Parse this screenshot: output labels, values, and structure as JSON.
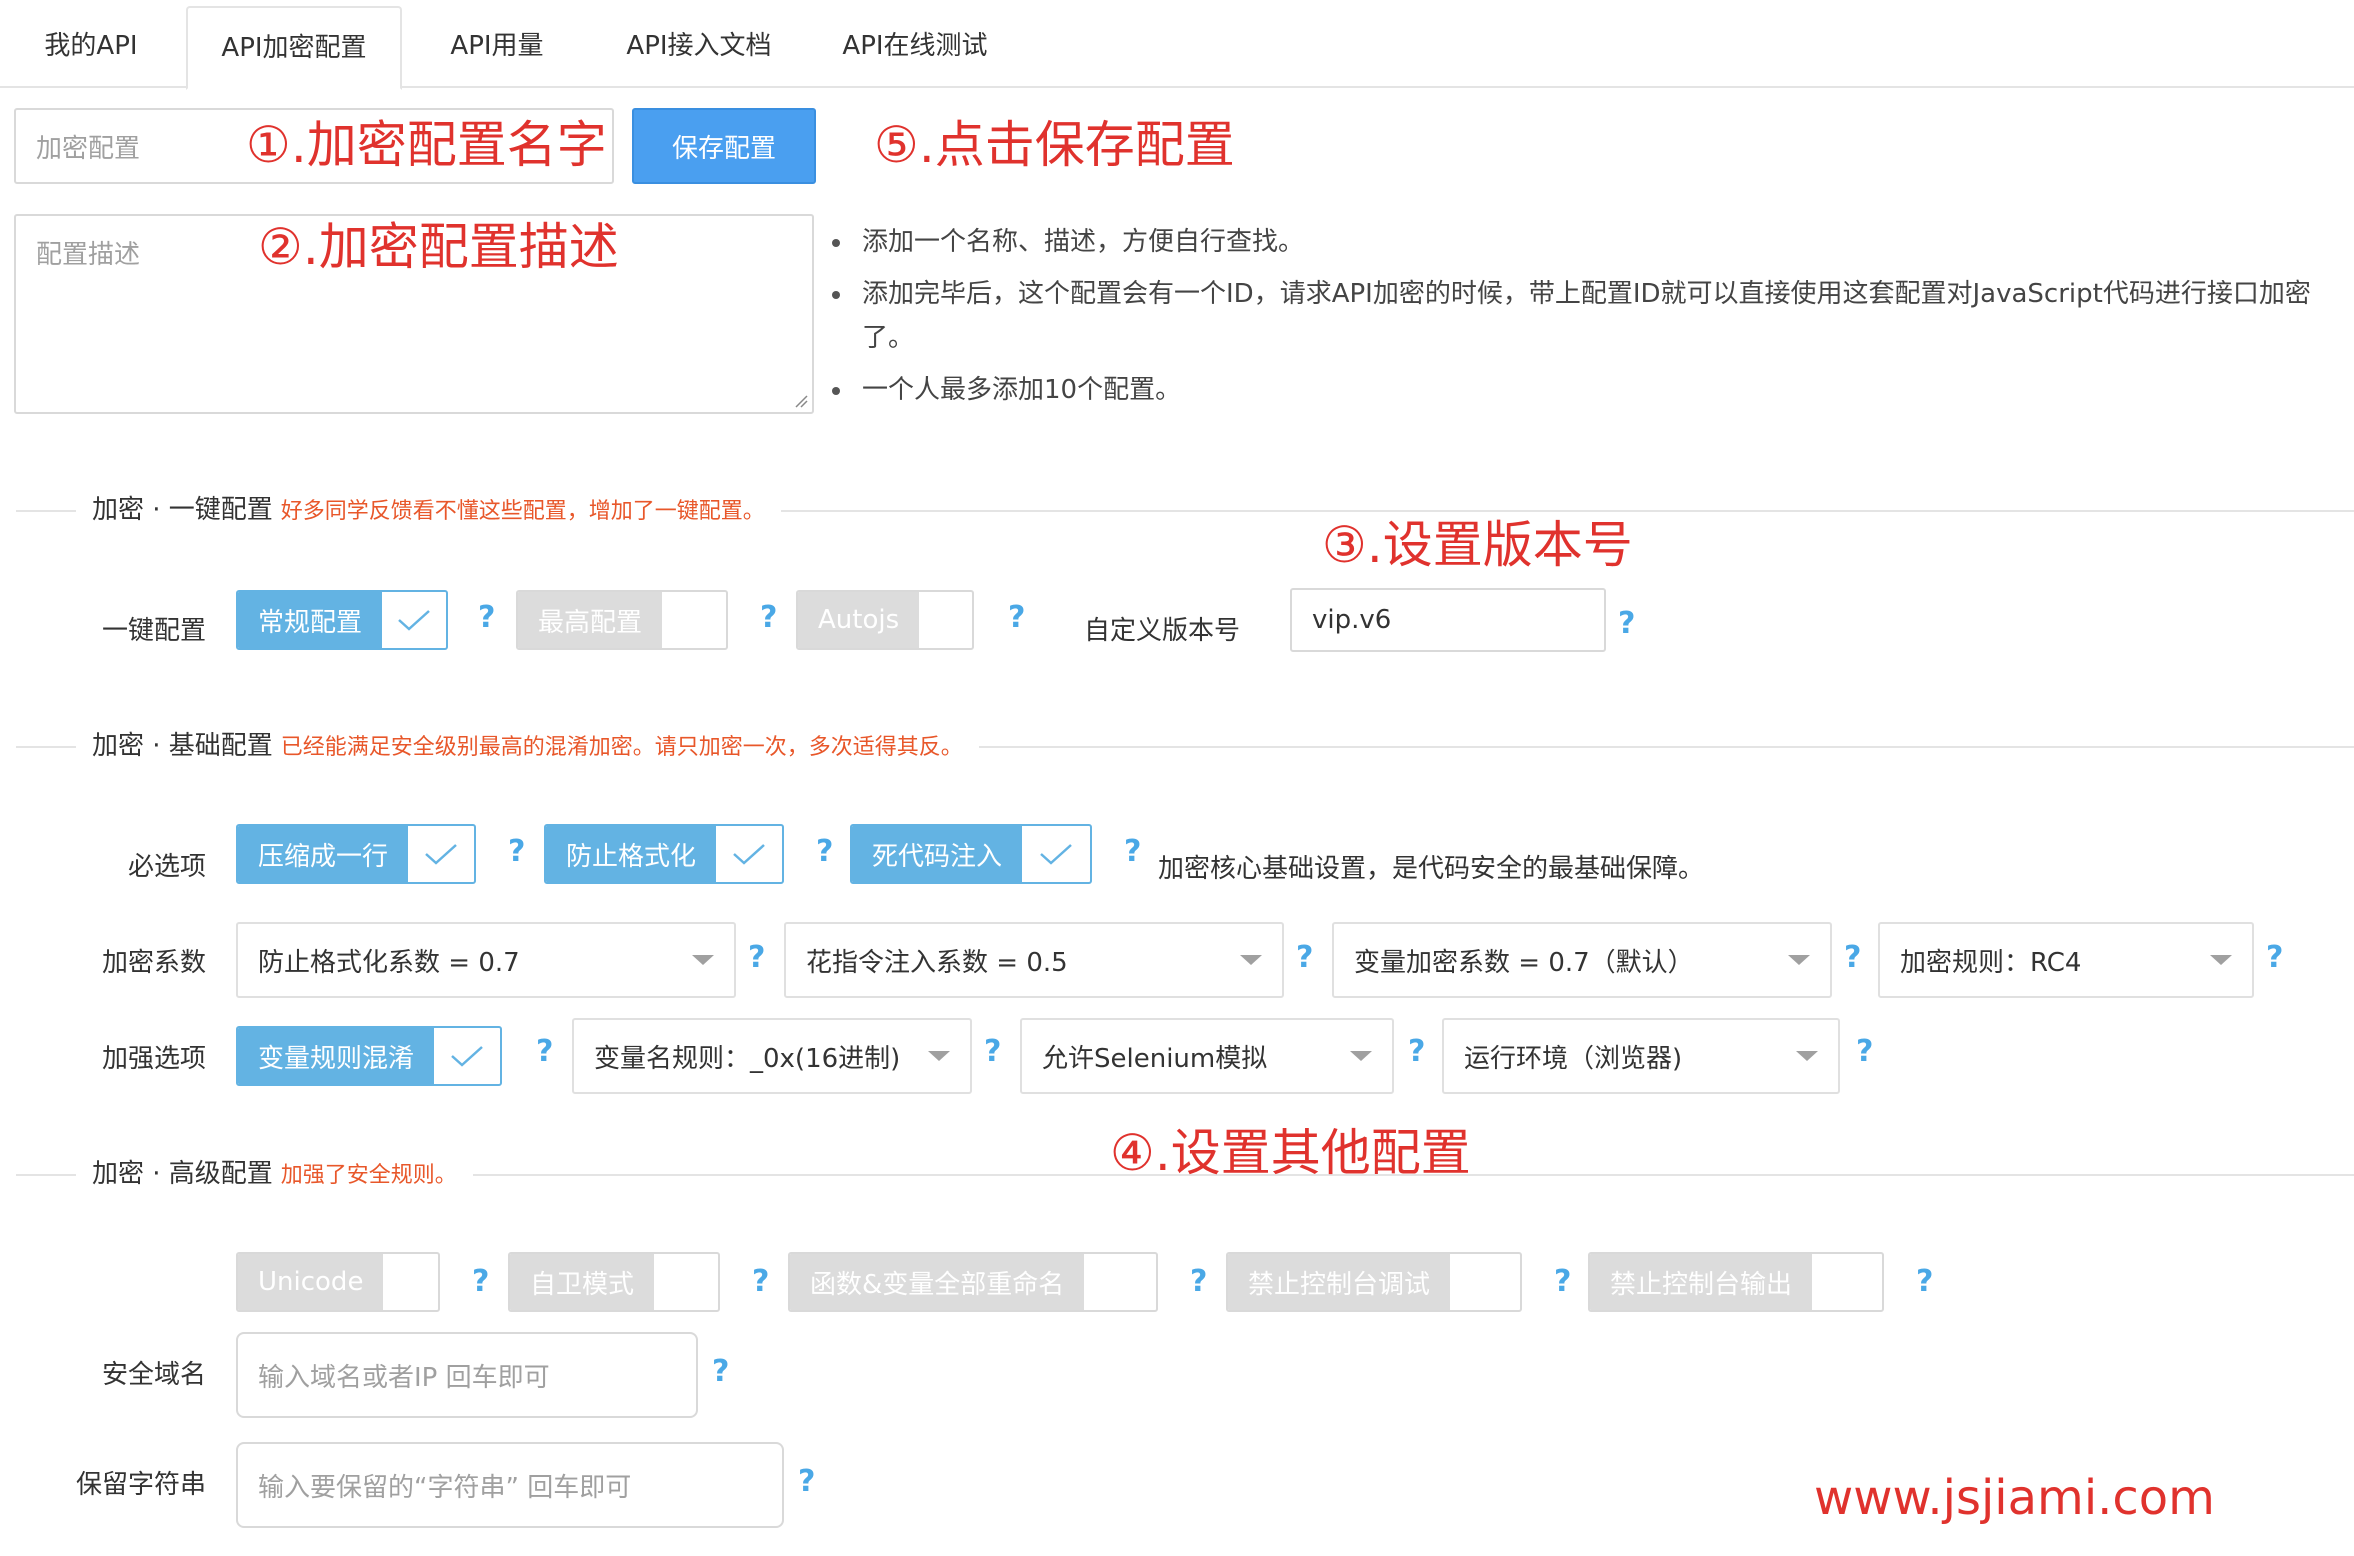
{
  "tabs": [
    "我的API",
    "API加密配置",
    "API用量",
    "API接入文档",
    "API在线测试"
  ],
  "config_name": {
    "placeholder": "加密配置",
    "save_label": "保存配置"
  },
  "config_desc": {
    "placeholder": "配置描述"
  },
  "annotations": {
    "a1": "①.加密配置名字",
    "a2": "②.加密配置描述",
    "a3": "③.设置版本号",
    "a4": "④.设置其他配置",
    "a5": "⑤.点击保存配置"
  },
  "tips": [
    "添加一个名称、描述，方便自行查找。",
    "添加完毕后，这个配置会有一个ID，请求API加密的时候，带上配置ID就可以直接使用这套配置对JavaScript代码进行接口加密了。",
    "一个人最多添加10个配置。"
  ],
  "sections": {
    "quick": {
      "title": "加密 · 一键配置",
      "note": "好多同学反馈看不懂这些配置，增加了一键配置。"
    },
    "basic": {
      "title": "加密 · 基础配置",
      "note": "已经能满足安全级别最高的混淆加密。请只加密一次，多次适得其反。"
    },
    "advanced": {
      "title": "加密 · 高级配置",
      "note": "加强了安全规则。"
    }
  },
  "quick": {
    "label": "一键配置",
    "options": [
      {
        "text": "常规配置",
        "checked": true
      },
      {
        "text": "最高配置",
        "checked": false
      },
      {
        "text": "Autojs",
        "checked": false
      }
    ],
    "version_label": "自定义版本号",
    "version_value": "vip.v6"
  },
  "basic": {
    "required_label": "必选项",
    "required": [
      "压缩成一行",
      "防止格式化",
      "死代码注入"
    ],
    "required_note": "加密核心基础设置，是代码安全的最基础保障。",
    "coef_label": "加密系数",
    "coefs": [
      "防止格式化系数 = 0.7",
      "花指令注入系数 = 0.5",
      "变量加密系数 = 0.7（默认）",
      "加密规则：RC4"
    ],
    "enhance_label": "加强选项",
    "enhance_check": "变量规则混淆",
    "enhance_selects": [
      "变量名规则：_0x(16进制)",
      "允许Selenium模拟",
      "运行环境（浏览器)"
    ]
  },
  "advanced": {
    "options": [
      "Unicode",
      "自卫模式",
      "函数&变量全部重命名",
      "禁止控制台调试",
      "禁止控制台输出"
    ],
    "domain_label": "安全域名",
    "domain_placeholder": "输入域名或者IP 回车即可",
    "reserve_label": "保留字符串",
    "reserve_placeholder": "输入要保留的“字符串” 回车即可"
  },
  "help_mark": "?",
  "watermark": "www.jsjiami.com",
  "colors": {
    "accent": "#4a9ff0",
    "checked": "#63b3e3",
    "annotation": "#e0322d",
    "note": "#e8572a"
  }
}
